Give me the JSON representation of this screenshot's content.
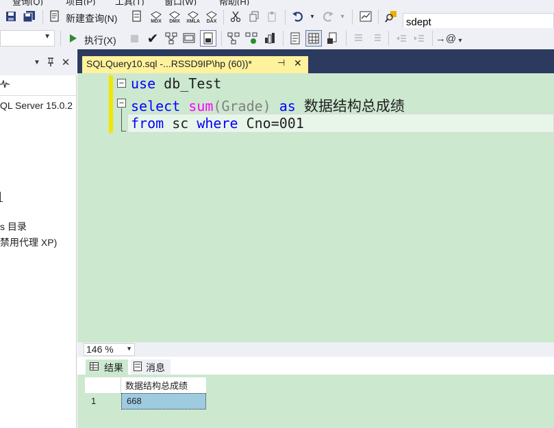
{
  "menubar": {
    "items": [
      "查询(Q)",
      "项目(P)",
      "工具(T)",
      "窗口(W)",
      "帮助(H)"
    ]
  },
  "toolbar1": {
    "new_query_label": "新建查询(N)",
    "mdx_label": "MDX",
    "dmx_label": "DMX",
    "xmla_label": "XMLA",
    "dax_label": "DAX",
    "search_value": "sdept"
  },
  "toolbar2": {
    "execute_label": "执行(X)"
  },
  "object_explorer": {
    "items": [
      {
        "label": "QL Server 15.0.2"
      },
      {
        "label": "s 目录"
      },
      {
        "label": "禁用代理 XP)"
      }
    ]
  },
  "editor": {
    "tab_title": "SQLQuery10.sql -...RSSD9IP\\hp (60))*",
    "pin_glyph": "⊣",
    "close_glyph": "✕",
    "lines": [
      {
        "kw1": "use",
        "rest": " db_Test"
      },
      {
        "kw1": "select",
        "fn": "sum",
        "paren": "(Grade)",
        "kw2": "as",
        "alias": "数据结构总成绩"
      },
      {
        "kw1": "from",
        "mid": " sc ",
        "kw2": "where",
        "rest": " Cno=001"
      }
    ],
    "zoom": "146 %"
  },
  "results": {
    "tab_results": "结果",
    "tab_messages": "消息",
    "columns": [
      "数据结构总成绩"
    ],
    "rows": [
      {
        "num": "1",
        "value": "668"
      }
    ]
  },
  "colors": {
    "editor_bg": "#cce8cf",
    "tab_highlight": "#fff29d",
    "keyword": "#0000ff",
    "function": "#ff00ff"
  }
}
